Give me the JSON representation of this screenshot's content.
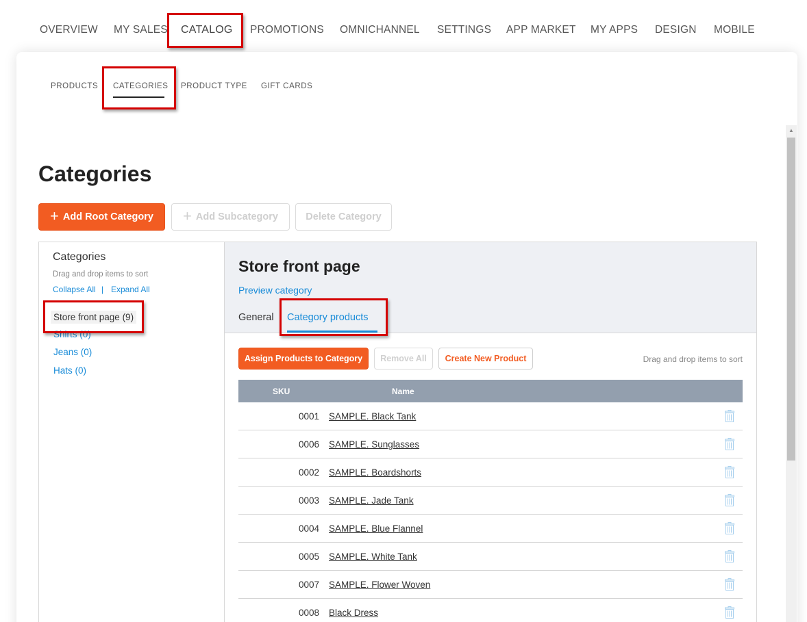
{
  "topnav": {
    "items": [
      "OVERVIEW",
      "MY SALES",
      "CATALOG",
      "PROMOTIONS",
      "OMNICHANNEL",
      "SETTINGS",
      "APP MARKET",
      "MY APPS",
      "DESIGN",
      "MOBILE"
    ],
    "active": "CATALOG"
  },
  "subnav": {
    "items": [
      "PRODUCTS",
      "CATEGORIES",
      "PRODUCT TYPE",
      "GIFT CARDS"
    ],
    "active": "CATEGORIES"
  },
  "page": {
    "title": "Categories",
    "add_root_label": "Add Root Category",
    "add_sub_label": "Add Subcategory",
    "delete_label": "Delete Category"
  },
  "left_panel": {
    "title": "Categories",
    "hint": "Drag and drop items to sort",
    "collapse_label": "Collapse All",
    "separator": "|",
    "expand_label": "Expand All",
    "tree": [
      "Store front page (9)",
      "Shirts (0)",
      "Jeans (0)",
      "Hats (0)"
    ]
  },
  "right_panel": {
    "title": "Store front page",
    "preview_label": "Preview category",
    "tabs": [
      "General",
      "Category products"
    ],
    "active_tab": "Category products",
    "assign_label": "Assign Products to Category",
    "remove_all_label": "Remove All",
    "create_label": "Create New Product",
    "hint": "Drag and drop items to sort",
    "columns": {
      "sku": "SKU",
      "name": "Name"
    },
    "rows": [
      {
        "sku": "0001",
        "name": "SAMPLE. Black Tank"
      },
      {
        "sku": "0006",
        "name": "SAMPLE. Sunglasses"
      },
      {
        "sku": "0002",
        "name": "SAMPLE. Boardshorts"
      },
      {
        "sku": "0003",
        "name": "SAMPLE. Jade Tank"
      },
      {
        "sku": "0004",
        "name": "SAMPLE. Blue Flannel"
      },
      {
        "sku": "0005",
        "name": "SAMPLE. White Tank"
      },
      {
        "sku": "0007",
        "name": "SAMPLE. Flower Woven"
      },
      {
        "sku": "0008",
        "name": "Black Dress"
      }
    ]
  },
  "colors": {
    "accent": "#f25c22",
    "link": "#1a8cd8",
    "highlight": "#d40000",
    "table_header": "#939fae"
  },
  "icons": {
    "plus": "plus-icon",
    "trash": "trash-icon",
    "scroll_up": "arrow-up-icon"
  }
}
